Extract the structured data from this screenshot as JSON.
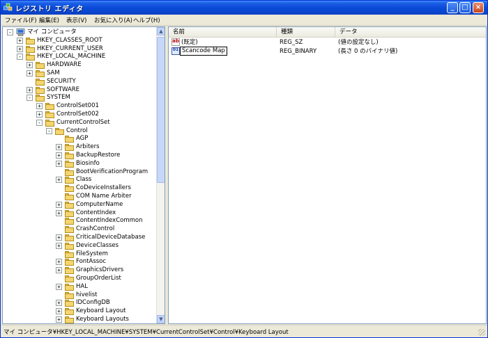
{
  "window": {
    "title": "レジストリ エディタ"
  },
  "menu": [
    "ファイル(F)",
    "編集(E)",
    "表示(V)",
    "お気に入り(A)",
    "ヘルプ(H)"
  ],
  "tree": [
    {
      "label": "マイ コンピュータ",
      "depth": 0,
      "expander": "-",
      "icon": "computer"
    },
    {
      "label": "HKEY_CLASSES_ROOT",
      "depth": 1,
      "expander": "+"
    },
    {
      "label": "HKEY_CURRENT_USER",
      "depth": 1,
      "expander": "+"
    },
    {
      "label": "HKEY_LOCAL_MACHINE",
      "depth": 1,
      "expander": "-"
    },
    {
      "label": "HARDWARE",
      "depth": 2,
      "expander": "+"
    },
    {
      "label": "SAM",
      "depth": 2,
      "expander": "+"
    },
    {
      "label": "SECURITY",
      "depth": 2,
      "expander": ""
    },
    {
      "label": "SOFTWARE",
      "depth": 2,
      "expander": "+"
    },
    {
      "label": "SYSTEM",
      "depth": 2,
      "expander": "-"
    },
    {
      "label": "ControlSet001",
      "depth": 3,
      "expander": "+"
    },
    {
      "label": "ControlSet002",
      "depth": 3,
      "expander": "+"
    },
    {
      "label": "CurrentControlSet",
      "depth": 3,
      "expander": "-"
    },
    {
      "label": "Control",
      "depth": 4,
      "expander": "-"
    },
    {
      "label": "AGP",
      "depth": 5,
      "expander": ""
    },
    {
      "label": "Arbiters",
      "depth": 5,
      "expander": "+"
    },
    {
      "label": "BackupRestore",
      "depth": 5,
      "expander": "+"
    },
    {
      "label": "Biosinfo",
      "depth": 5,
      "expander": "+"
    },
    {
      "label": "BootVerificationProgram",
      "depth": 5,
      "expander": ""
    },
    {
      "label": "Class",
      "depth": 5,
      "expander": "+"
    },
    {
      "label": "CoDeviceInstallers",
      "depth": 5,
      "expander": ""
    },
    {
      "label": "COM Name Arbiter",
      "depth": 5,
      "expander": ""
    },
    {
      "label": "ComputerName",
      "depth": 5,
      "expander": "+"
    },
    {
      "label": "ContentIndex",
      "depth": 5,
      "expander": "+"
    },
    {
      "label": "ContentIndexCommon",
      "depth": 5,
      "expander": ""
    },
    {
      "label": "CrashControl",
      "depth": 5,
      "expander": ""
    },
    {
      "label": "CriticalDeviceDatabase",
      "depth": 5,
      "expander": "+"
    },
    {
      "label": "DeviceClasses",
      "depth": 5,
      "expander": "+"
    },
    {
      "label": "FileSystem",
      "depth": 5,
      "expander": ""
    },
    {
      "label": "FontAssoc",
      "depth": 5,
      "expander": "+"
    },
    {
      "label": "GraphicsDrivers",
      "depth": 5,
      "expander": "+"
    },
    {
      "label": "GroupOrderList",
      "depth": 5,
      "expander": ""
    },
    {
      "label": "HAL",
      "depth": 5,
      "expander": "+"
    },
    {
      "label": "hivelist",
      "depth": 5,
      "expander": ""
    },
    {
      "label": "IDConfigDB",
      "depth": 5,
      "expander": "+"
    },
    {
      "label": "Keyboard Layout",
      "depth": 5,
      "expander": "+"
    },
    {
      "label": "Keyboard Layouts",
      "depth": 5,
      "expander": "+"
    }
  ],
  "list": {
    "columns": [
      "名前",
      "種類",
      "データ"
    ],
    "rows": [
      {
        "name": "(既定)",
        "type": "REG_SZ",
        "data": "(値の設定なし)",
        "icon": "string"
      },
      {
        "name": "Scancode Map",
        "type": "REG_BINARY",
        "data": "(長さ 0 のバイナリ値)",
        "icon": "binary",
        "editing": true
      }
    ]
  },
  "status": {
    "path": "マイ コンピュータ¥HKEY_LOCAL_MACHINE¥SYSTEM¥CurrentControlSet¥Control¥Keyboard Layout"
  }
}
